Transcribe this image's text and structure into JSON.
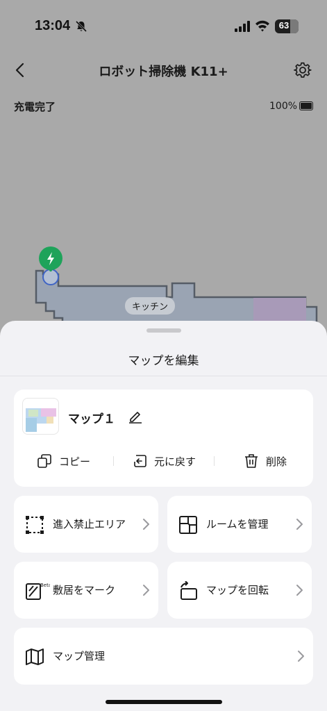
{
  "status_bar": {
    "time": "13:04",
    "battery_level": "63"
  },
  "header": {
    "title": "ロボット掃除機 K11+"
  },
  "device": {
    "charge_status": "充電完了",
    "battery_percent": "100%"
  },
  "map": {
    "room_label": "キッチン"
  },
  "sheet": {
    "title": "マップを編集",
    "map_card": {
      "name": "マップ１",
      "actions": [
        {
          "label": "コピー",
          "icon": "copy-icon"
        },
        {
          "label": "元に戻す",
          "icon": "undo-icon"
        },
        {
          "label": "削除",
          "icon": "trash-icon"
        }
      ]
    },
    "tiles": [
      {
        "label": "進入禁止エリア",
        "icon": "no-go-zone-icon"
      },
      {
        "label": "ルームを管理",
        "icon": "room-layout-icon"
      },
      {
        "label": "敷居をマーク",
        "icon": "threshold-icon",
        "badge": "Beta"
      },
      {
        "label": "マップを回転",
        "icon": "rotate-icon"
      },
      {
        "label": "マップ管理",
        "icon": "map-icon"
      }
    ]
  }
}
